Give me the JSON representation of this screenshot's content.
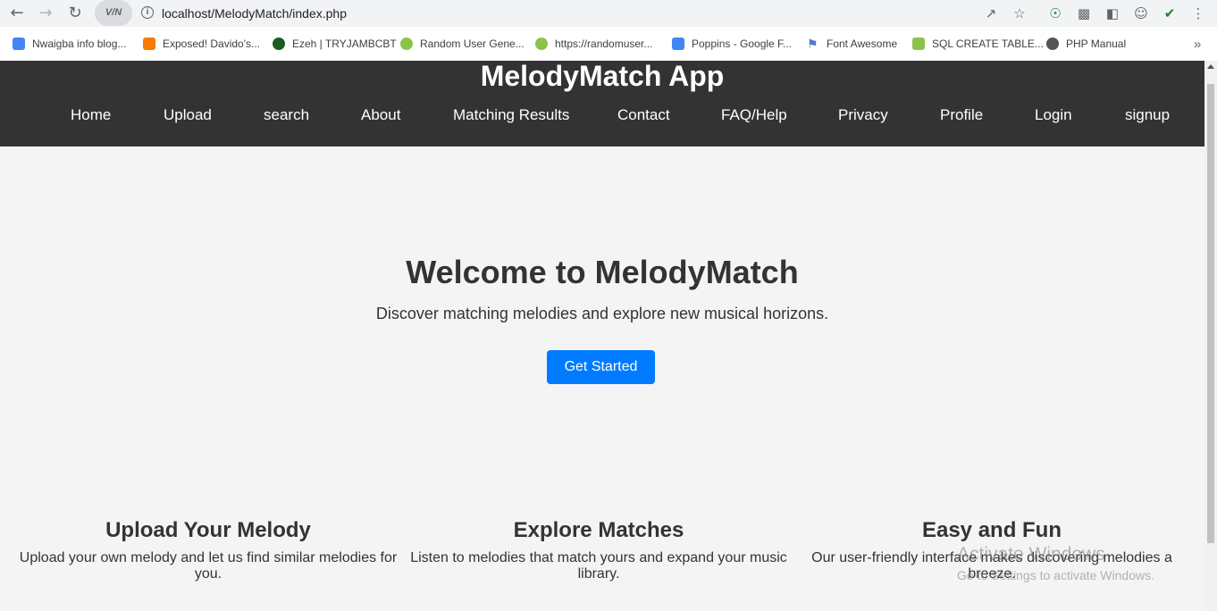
{
  "browser": {
    "url": "localhost/MelodyMatch/index.php",
    "vpn_label": "V/N",
    "bookmarks": [
      {
        "label": "Nwaigba info blog...",
        "color": "#4285f4"
      },
      {
        "label": "Exposed! Davido's...",
        "color": "#f57c00"
      },
      {
        "label": "Ezeh | TRYJAMBCBT",
        "color": "#1b5e20"
      },
      {
        "label": "Random User Gene...",
        "color": "#8bc34a"
      },
      {
        "label": "https://randomuser...",
        "color": "#8bc34a"
      },
      {
        "label": "Poppins - Google F...",
        "color": "#4285f4"
      },
      {
        "label": "Font Awesome",
        "color": "#4a7cc9"
      },
      {
        "label": "SQL CREATE TABLE...",
        "color": "#8bc34a"
      },
      {
        "label": "PHP Manual",
        "color": "#555555"
      }
    ]
  },
  "site": {
    "title": "MelodyMatch App",
    "nav": [
      "Home",
      "Upload",
      "search",
      "About",
      "Matching Results",
      "Contact",
      "FAQ/Help",
      "Privacy",
      "Profile",
      "Login",
      "signup"
    ]
  },
  "hero": {
    "title": "Welcome to MelodyMatch",
    "subtitle": "Discover matching melodies and explore new musical horizons.",
    "cta_label": "Get Started"
  },
  "features": [
    {
      "title": "Upload Your Melody",
      "text": "Upload your own melody and let us find similar melodies for you."
    },
    {
      "title": "Explore Matches",
      "text": "Listen to melodies that match yours and expand your music library."
    },
    {
      "title": "Easy and Fun",
      "text": "Our user-friendly interface makes discovering melodies a breeze."
    }
  ],
  "watermark": {
    "line1": "Activate Windows",
    "line2": "Go to Settings to activate Windows."
  },
  "colors": {
    "header_bg": "#333333",
    "cta_bg": "#007bff",
    "page_bg": "#f4f4f4"
  }
}
